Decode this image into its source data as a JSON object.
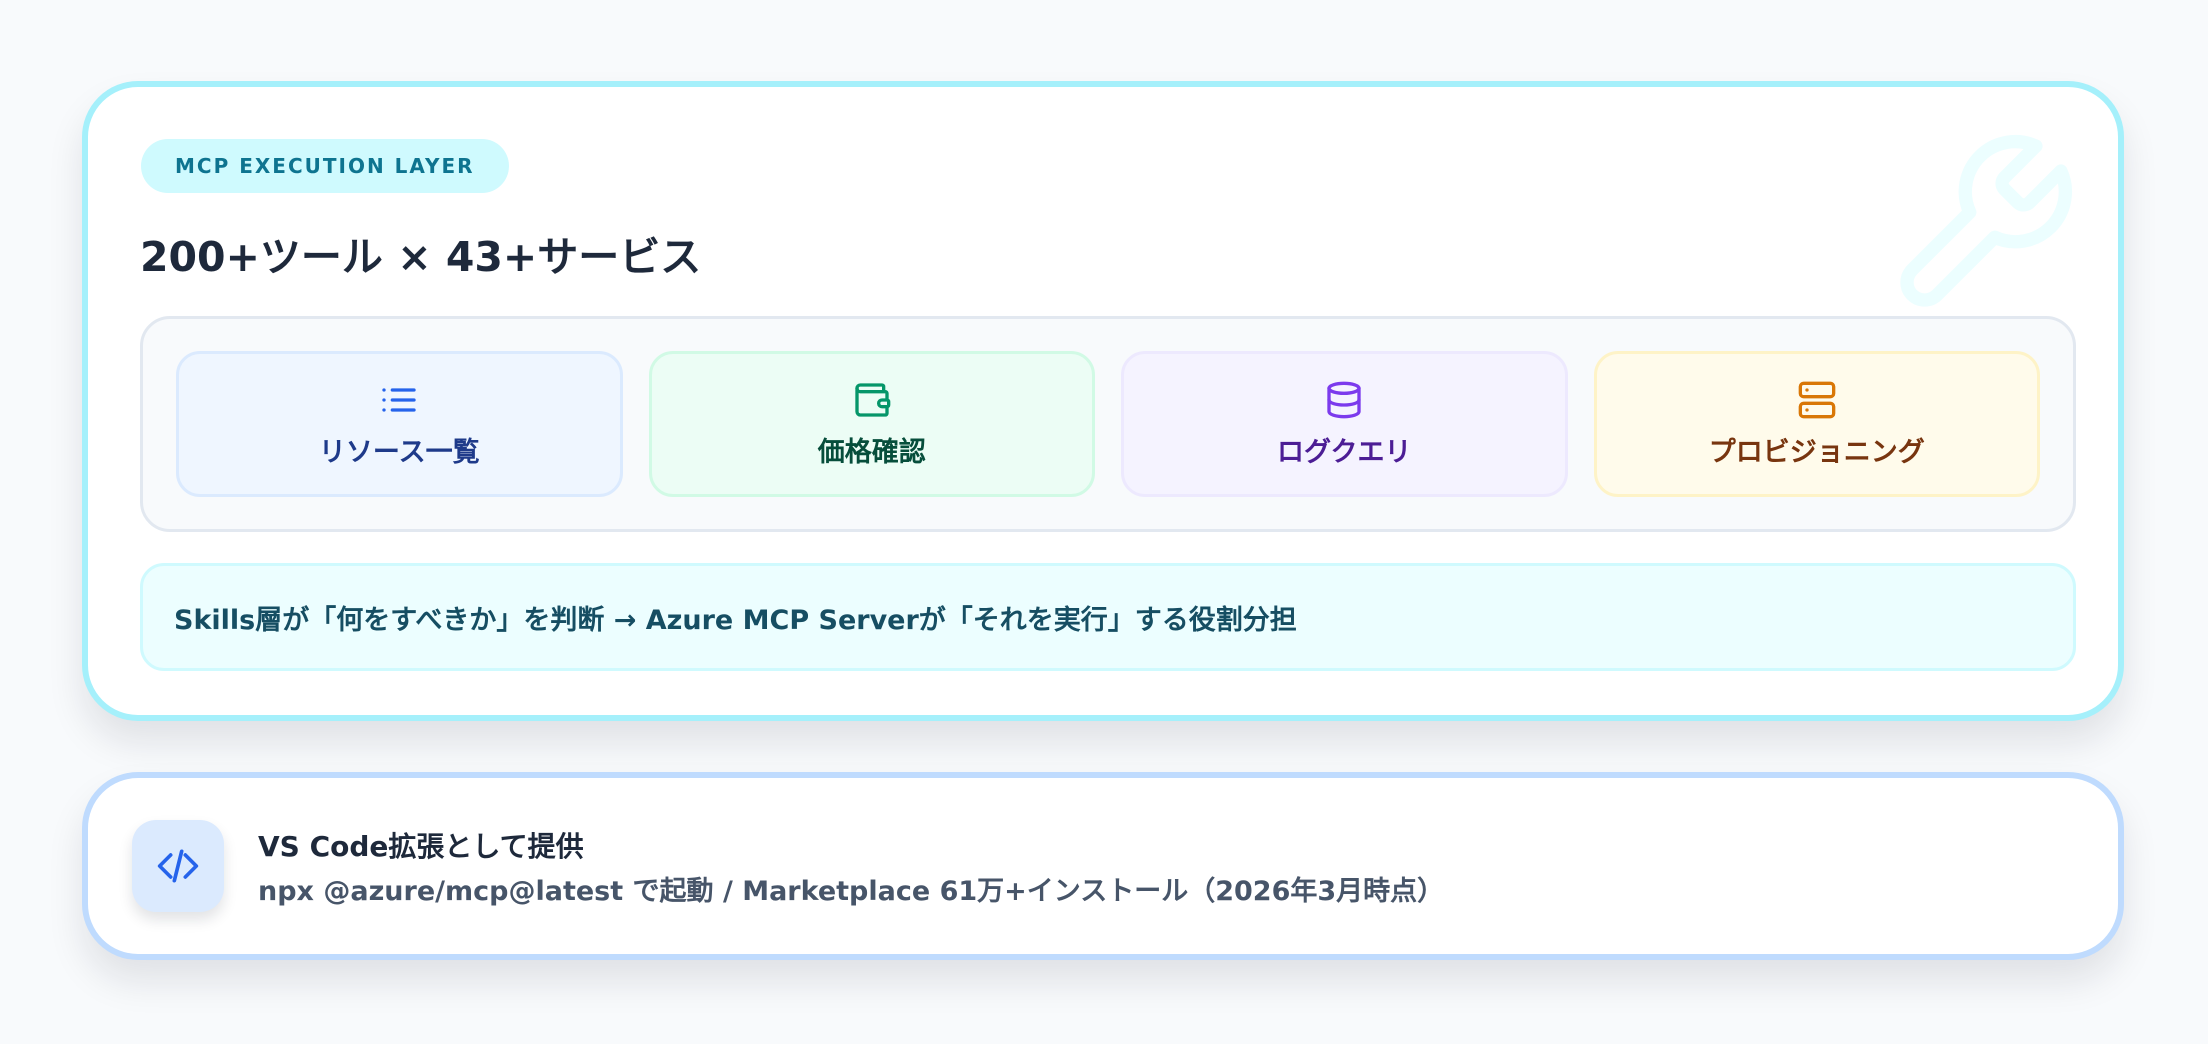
{
  "mcp": {
    "badge": "MCP EXECUTION LAYER",
    "title": "200+ツール × 43+サービス",
    "tools": [
      {
        "label": "リソース一覧",
        "icon": "list-icon",
        "color": "#2563eb"
      },
      {
        "label": "価格確認",
        "icon": "wallet-icon",
        "color": "#059669"
      },
      {
        "label": "ログクエリ",
        "icon": "database-icon",
        "color": "#7c3aed"
      },
      {
        "label": "プロビジョニング",
        "icon": "server-icon",
        "color": "#d97706"
      }
    ],
    "role_note": "Skills層が「何をすべきか」を判断 → Azure MCP Serverが「それを実行」する役割分担",
    "watermark_icon": "wrench-icon"
  },
  "vscode": {
    "icon": "code-icon",
    "title": "VS Code拡張として提供",
    "subtitle": "npx @azure/mcp@latest で起動 / Marketplace 61万+インストール（2026年3月時点）"
  },
  "colors": {
    "accent_cyan": "#a5f0fb",
    "accent_blue": "#2563eb",
    "text_dark": "#1e293b"
  }
}
